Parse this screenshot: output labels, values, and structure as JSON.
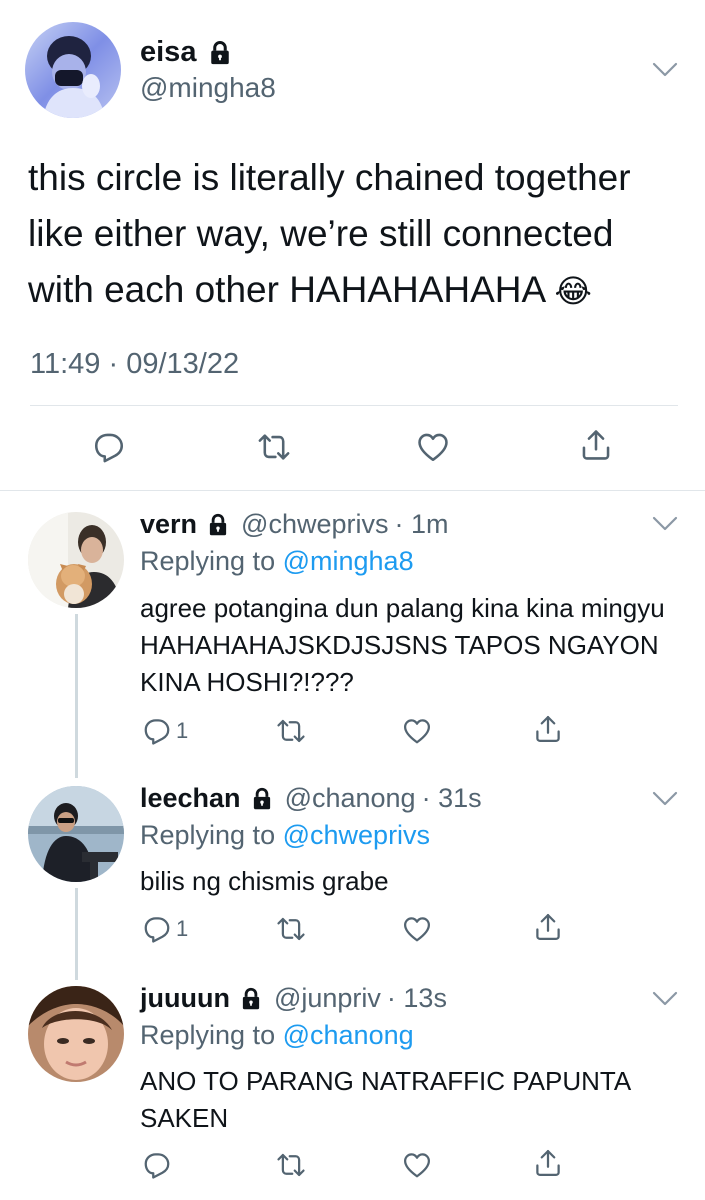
{
  "main_tweet": {
    "name": "eisa",
    "handle": "@mingha8",
    "text": "this circle is literally chained together like either way, we’re still connected with each other HAHAHAHAHA",
    "timestamp": "11:49 · 09/13/22",
    "emoji": "😂"
  },
  "replies": [
    {
      "name": "vern",
      "handle": "@chweprivs",
      "time": "· 1m",
      "replying_prefix": "Replying to",
      "replying_to": "@mingha8",
      "text": "agree potangina dun palang kina kina mingyu HAHAHAHAJSKDJSJSNS TAPOS NGAYON KINA HOSHI?!???",
      "reply_count": "1"
    },
    {
      "name": "leechan",
      "handle": "@chanong",
      "time": "· 31s",
      "replying_prefix": "Replying to",
      "replying_to": "@chweprivs",
      "text": "bilis ng chismis grabe",
      "reply_count": "1"
    },
    {
      "name": "juuuun",
      "handle": "@junpriv",
      "time": "· 13s",
      "replying_prefix": "Replying to",
      "replying_to": "@chanong",
      "text": "ANO TO PARANG NATRAFFIC PAPUNTA SAKEN",
      "reply_count": ""
    }
  ],
  "colors": {
    "link": "#1d9bf0",
    "secondary": "#536471",
    "divider": "#e1e6ea"
  },
  "icons": [
    "lock-icon",
    "chevron-down-icon",
    "reply-icon",
    "retweet-icon",
    "like-icon",
    "share-icon"
  ]
}
